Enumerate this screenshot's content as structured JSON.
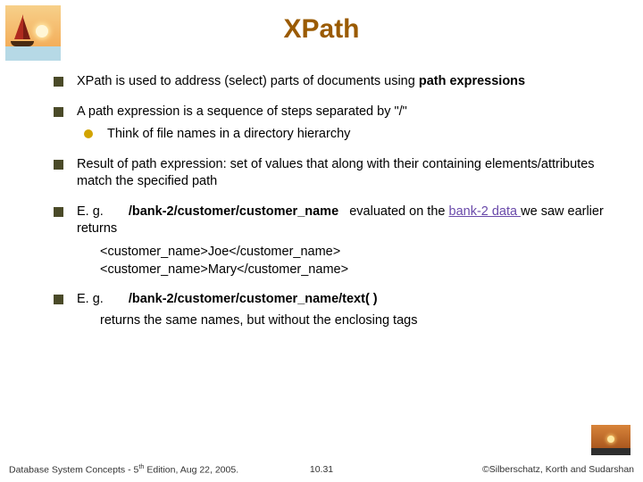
{
  "title": "XPath",
  "bullets": {
    "b1_a": "XPath is used to address (select) parts of documents using ",
    "b1_b": "path expressions",
    "b2": "A path expression is a sequence of steps separated by \"/\"",
    "b2_sub": "Think of file names in a directory hierarchy",
    "b3": "Result of path expression:  set of values that along with their containing elements/attributes match the specified path",
    "b4_a": "E. g.",
    "b4_path": "/bank-2/customer/customer_name",
    "b4_b": "evaluated on the ",
    "b4_link": "bank-2 data ",
    "b4_c": "we saw earlier returns",
    "b4_code1": "<customer_name>Joe</customer_name>",
    "b4_code2": "<customer_name>Mary</customer_name>",
    "b5_a": "E. g.",
    "b5_path": "/bank-2/customer/customer_name/text( )",
    "b5_b": "returns the same names, but without the enclosing tags"
  },
  "footer": {
    "left_a": "Database System Concepts - 5",
    "left_sup": "th",
    "left_b": " Edition, Aug 22, 2005.",
    "mid": "10.31",
    "right": "©Silberschatz, Korth and Sudarshan"
  }
}
